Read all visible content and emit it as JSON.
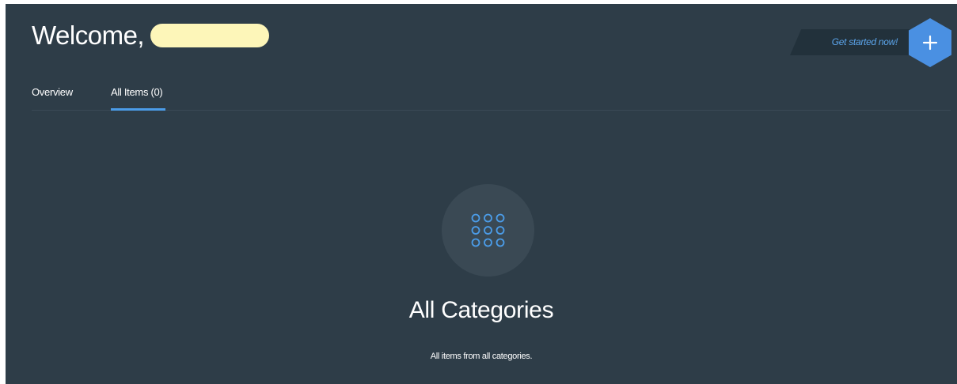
{
  "header": {
    "welcome_text": "Welcome,"
  },
  "tabs": [
    {
      "label": "Overview"
    },
    {
      "label": "All Items (0)"
    }
  ],
  "cta": {
    "label": "Get started now!"
  },
  "add_button": {
    "icon": "plus-icon",
    "color": "#4a90e2"
  },
  "main": {
    "icon": "grid-dots-icon",
    "title": "All Categories",
    "subtitle": "All items from all categories."
  },
  "colors": {
    "background": "#2e3d48",
    "accent": "#4b9ce8",
    "redaction": "#fdf6b9"
  }
}
